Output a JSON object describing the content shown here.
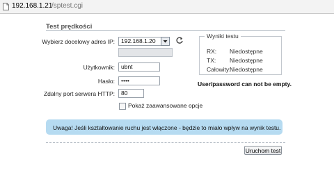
{
  "browser": {
    "url_host": "192.168.1.21",
    "url_path": "/sptest.cgi"
  },
  "section": {
    "title": "Test prędkości"
  },
  "form": {
    "ip_label": "Wybierz docelowy adres IP:",
    "ip_value": "192.168.1.20",
    "ip_custom_value": "",
    "user_label": "Użytkownik:",
    "user_value": "ubnt",
    "pass_label": "Hasło:",
    "pass_value": "••••",
    "port_label": "Zdalny port serwera HTTP:",
    "port_value": "80",
    "advanced_label": "Pokaż zaawansowane opcje"
  },
  "results": {
    "legend": "Wyniki testu",
    "rx_label": "RX:",
    "rx_value": "Niedostępne",
    "tx_label": "TX:",
    "tx_value": "Niedostępne",
    "total_label": "Całowity:",
    "total_value": "Niedostępne"
  },
  "error_message": "User/password can not be empty.",
  "info_banner": "Uwaga! Jeśli kształtowanie ruchu jest włączone - będzie to miało wpływ na wynik testu.",
  "run_button_label": "Uruchom test",
  "icons": {
    "page": "document-icon",
    "refresh": "refresh-icon",
    "dropdown": "chevron-down-icon"
  }
}
